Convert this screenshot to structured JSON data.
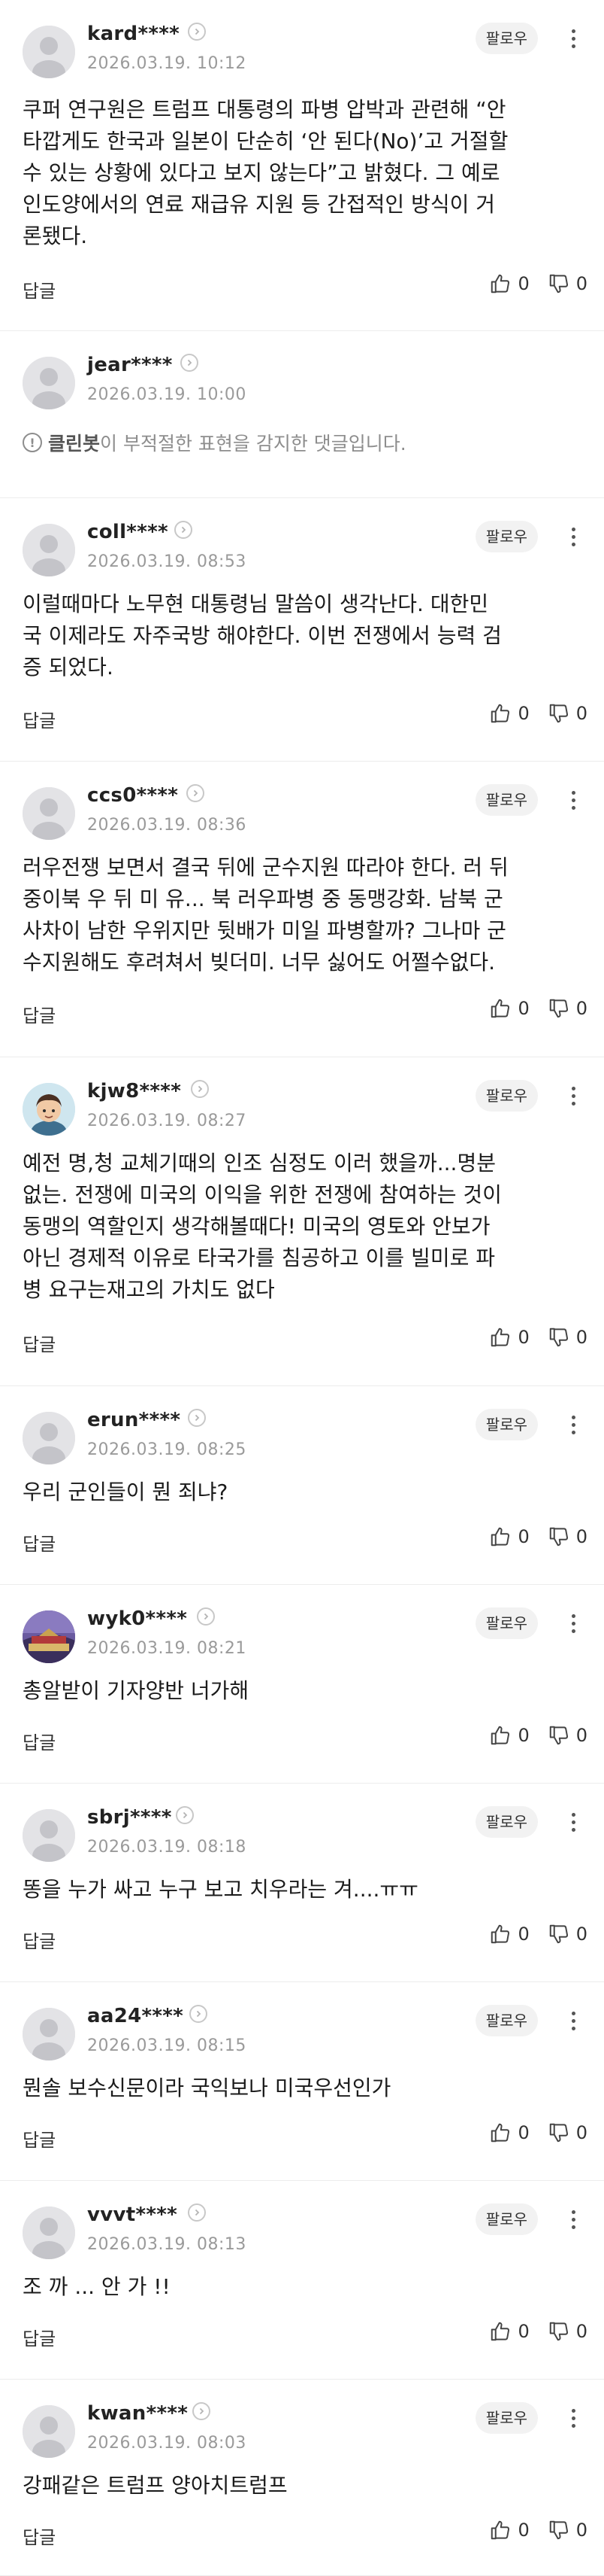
{
  "follow_label": "팔로우",
  "reply_label": "답글",
  "blocked_notice": {
    "bot": "클린봇",
    "rest": "이 부적절한 표현을 감지한 댓글입니다."
  },
  "comments": [
    {
      "username": "kard****",
      "date": "2026.03.19. 10:12",
      "text": "쿠퍼 연구원은 트럼프 대통령의 파병 압박과 관련해 “안\n타깝게도 한국과 일본이 단순히 ‘안 된다(No)’고 거절할\n수 있는 상황에 있다고 보지 않는다”고 밝혔다. 그 예로\n인도양에서의 연료 재급유 지원 등 간접적인 방식이 거\n론됐다.",
      "likes": "0",
      "dislikes": "0"
    },
    {
      "username": "jear****",
      "date": "2026.03.19. 10:00",
      "text": "",
      "likes": "",
      "dislikes": ""
    },
    {
      "username": "coll****",
      "date": "2026.03.19. 08:53",
      "text": "이럴때마다 노무현 대통령님 말씀이 생각난다. 대한민\n국 이제라도 자주국방 해야한다. 이번 전쟁에서 능력 검\n증 되었다.",
      "likes": "0",
      "dislikes": "0"
    },
    {
      "username": "ccs0****",
      "date": "2026.03.19. 08:36",
      "text": "러우전쟁 보면서 결국 뒤에 군수지원 따라야 한다. 러 뒤\n중이북 우 뒤 미 유... 북 러우파병 중 동맹강화. 남북 군\n사차이 남한 우위지만 뒷배가 미일 파병할까? 그나마 군\n수지원해도 후려쳐서 빚더미. 너무 싫어도 어쩔수없다.",
      "likes": "0",
      "dislikes": "0"
    },
    {
      "username": "kjw8****",
      "date": "2026.03.19. 08:27",
      "text": "예전 명,청 교체기때의 인조 심정도 이러 했을까...명분\n없는. 전쟁에 미국의 이익을 위한 전쟁에 참여하는 것이\n동맹의 역할인지 생각해볼때다! 미국의 영토와 안보가\n아닌 경제적 이유로 타국가를 침공하고 이를 빌미로 파\n병 요구는재고의 가치도 없다",
      "likes": "0",
      "dislikes": "0"
    },
    {
      "username": "erun****",
      "date": "2026.03.19. 08:25",
      "text": "우리 군인들이 뭔 죄냐?",
      "likes": "0",
      "dislikes": "0"
    },
    {
      "username": "wyk0****",
      "date": "2026.03.19. 08:21",
      "text": "총알받이 기자양반 너가해",
      "likes": "0",
      "dislikes": "0"
    },
    {
      "username": "sbrj****",
      "date": "2026.03.19. 08:18",
      "text": "똥을 누가 싸고 누구 보고 치우라는 겨....ㅠㅠ",
      "likes": "0",
      "dislikes": "0"
    },
    {
      "username": "aa24****",
      "date": "2026.03.19. 08:15",
      "text": "뭔솔 보수신문이라 국익보나 미국우선인가",
      "likes": "0",
      "dislikes": "0"
    },
    {
      "username": "vvvt****",
      "date": "2026.03.19. 08:13",
      "text": "조 까 ... 안 가 !!",
      "likes": "0",
      "dislikes": "0"
    },
    {
      "username": "kwan****",
      "date": "2026.03.19. 08:03",
      "text": "강패같은 트럼프 양아치트럼프",
      "likes": "0",
      "dislikes": "0"
    }
  ]
}
